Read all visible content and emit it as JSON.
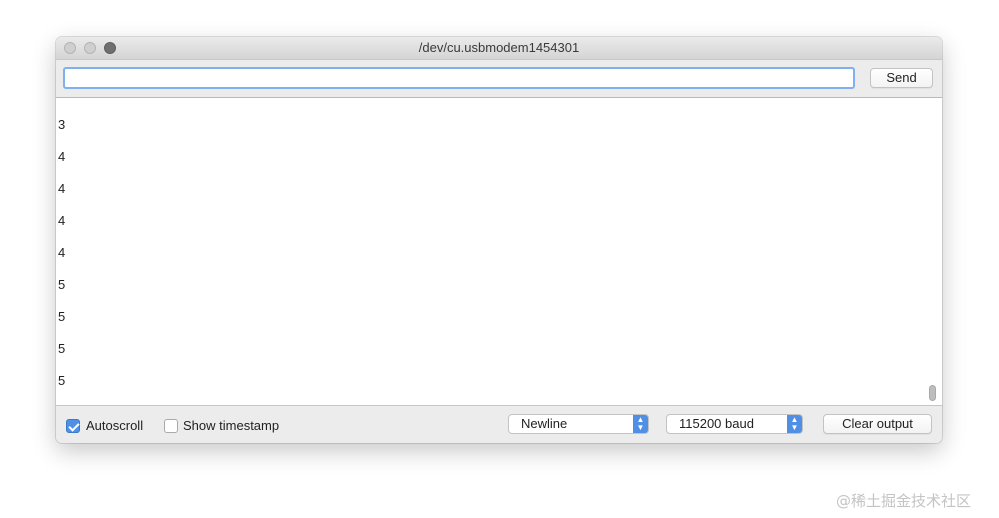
{
  "window": {
    "title": "/dev/cu.usbmodem1454301"
  },
  "toolbar": {
    "input_value": "",
    "send_label": "Send"
  },
  "output": {
    "lines": [
      "3",
      "4",
      "4",
      "4",
      "4",
      "5",
      "5",
      "5",
      "5"
    ]
  },
  "footer": {
    "autoscroll_label": "Autoscroll",
    "autoscroll_checked": true,
    "timestamp_label": "Show timestamp",
    "timestamp_checked": false,
    "line_ending": "Newline",
    "baud_rate": "115200 baud",
    "clear_label": "Clear output"
  },
  "watermark": "@稀土掘金技术社区",
  "colors": {
    "accent": "#4f8fe6",
    "focus_ring": "#7fb0ef"
  }
}
